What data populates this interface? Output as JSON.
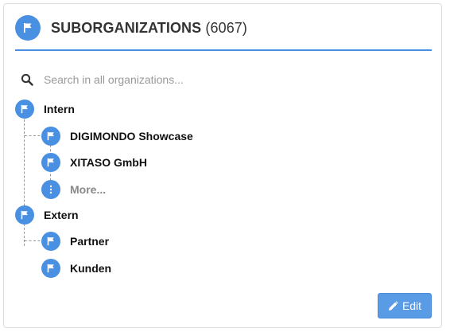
{
  "header": {
    "title": "SUBORGANIZATIONS",
    "count": "(6067)",
    "icon": "flag-icon",
    "accent_color": "#4a90e2"
  },
  "search": {
    "placeholder": "Search in all organizations...",
    "value": "",
    "icon": "search-icon"
  },
  "tree": [
    {
      "label": "Intern",
      "icon": "flag-icon",
      "children": [
        {
          "label": "DIGIMONDO Showcase",
          "icon": "flag-icon"
        },
        {
          "label": "XITASO GmbH",
          "icon": "flag-icon"
        },
        {
          "label": "More...",
          "icon": "more-vertical-icon"
        }
      ]
    },
    {
      "label": "Extern",
      "icon": "flag-icon",
      "children": [
        {
          "label": "Partner",
          "icon": "flag-icon"
        },
        {
          "label": "Kunden",
          "icon": "flag-icon"
        }
      ]
    }
  ],
  "footer": {
    "edit_label": "Edit",
    "edit_icon": "pencil-icon",
    "button_color": "#5a9be6"
  }
}
